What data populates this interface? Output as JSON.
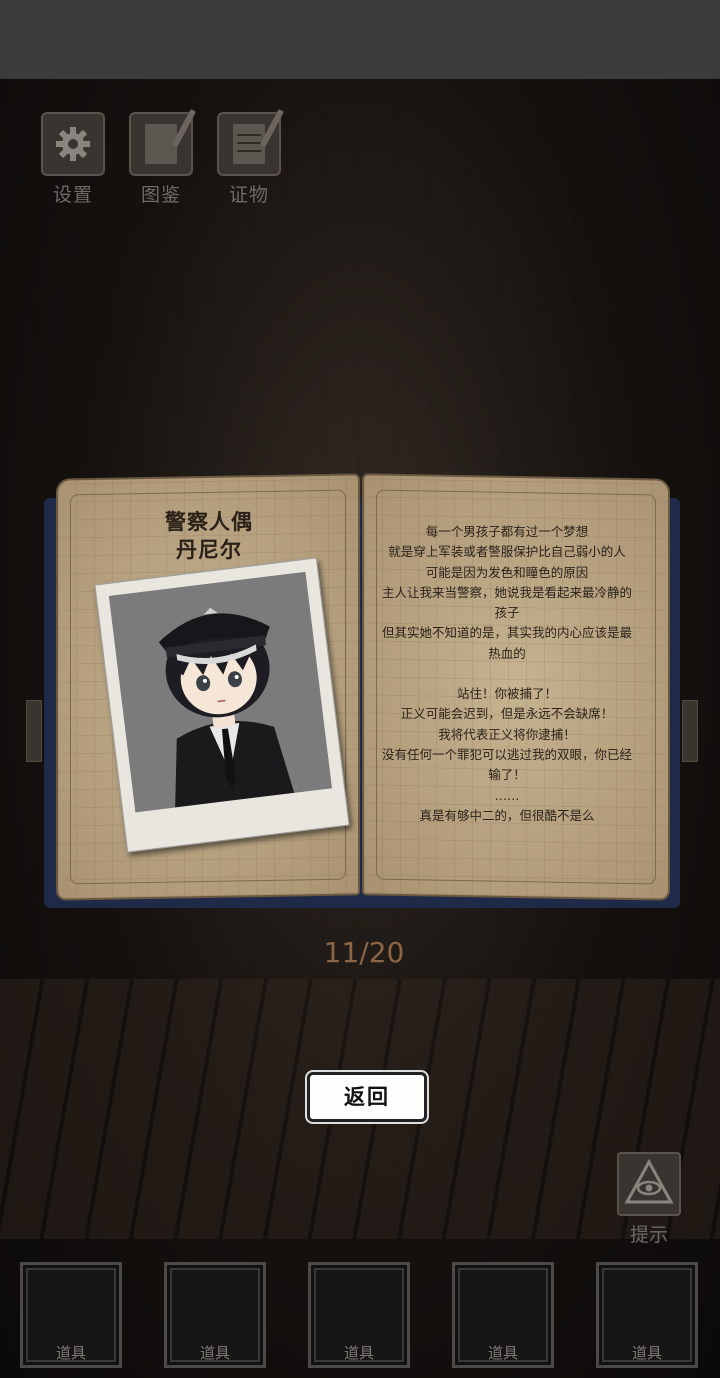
{
  "top_menu": [
    {
      "label": "设置",
      "icon": "gear-icon"
    },
    {
      "label": "图鉴",
      "icon": "notebook-icon"
    },
    {
      "label": "证物",
      "icon": "evidence-notebook-icon"
    }
  ],
  "book": {
    "title_line1": "警察人偶",
    "title_line2": "丹尼尔",
    "description_lines": [
      "每一个男孩子都有过一个梦想",
      "就是穿上军装或者警服保护比自己弱小的人",
      "可能是因为发色和瞳色的原因",
      "主人让我来当警察，她说我是看起来最冷静的",
      "孩子",
      "但其实她不知道的是，其实我的内心应该是最",
      "热血的",
      "",
      "站住！你被捕了！",
      "正义可能会迟到，但是永远不会缺席！",
      "我将代表正义将你逮捕！",
      "没有任何一个罪犯可以逃过我的双眼，你已经",
      "输了！",
      "……",
      "真是有够中二的，但很酷不是么"
    ]
  },
  "pager": {
    "counter": "11/20"
  },
  "back_button": {
    "label": "返回"
  },
  "hint": {
    "label": "提示",
    "icon": "eye-pyramid-icon"
  },
  "inventory": [
    {
      "label": "道具"
    },
    {
      "label": "道具"
    },
    {
      "label": "道具"
    },
    {
      "label": "道具"
    },
    {
      "label": "道具"
    }
  ],
  "colors": {
    "page": "#b9a483",
    "cover": "#1e2a48",
    "counter": "#8c6546"
  }
}
